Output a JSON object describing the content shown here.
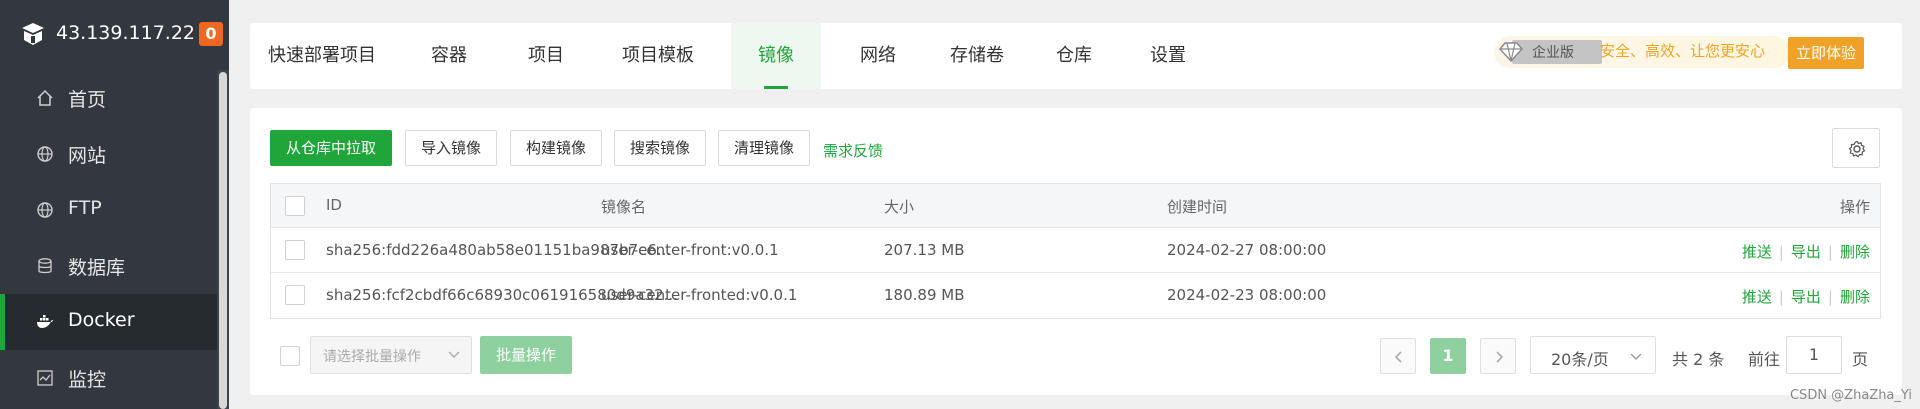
{
  "sidebar": {
    "host": "43.139.117.22",
    "badge": "0",
    "items": [
      {
        "label": "首页",
        "icon": "home-icon"
      },
      {
        "label": "网站",
        "icon": "globe-icon"
      },
      {
        "label": "FTP",
        "icon": "globe-icon"
      },
      {
        "label": "数据库",
        "icon": "database-icon"
      },
      {
        "label": "Docker",
        "icon": "docker-icon",
        "active": true
      },
      {
        "label": "监控",
        "icon": "monitor-icon"
      }
    ]
  },
  "tabs": {
    "items": [
      "快速部署项目",
      "容器",
      "项目",
      "项目模板",
      "镜像",
      "网络",
      "存储卷",
      "仓库",
      "设置"
    ],
    "active": "镜像"
  },
  "enterprise": {
    "tag": "企业版",
    "slogan": "安全、高效、让您更安心",
    "try_label": "立即体验"
  },
  "toolbar": {
    "pull": "从仓库中拉取",
    "import": "导入镜像",
    "build": "构建镜像",
    "search": "搜索镜像",
    "clean": "清理镜像",
    "feedback": "需求反馈"
  },
  "table": {
    "headers": {
      "id": "ID",
      "name": "镜像名",
      "size": "大小",
      "created": "创建时间",
      "ops": "操作"
    },
    "rows": [
      {
        "id": "sha256:fdd226a480ab58e01151ba987b7e6...",
        "name": "user-center-front:v0.0.1",
        "size": "207.13 MB",
        "created": "2024-02-27 08:00:00"
      },
      {
        "id": "sha256:fcf2cbdf66c68930c061916580d9a32...",
        "name": "user-center-fronted:v0.0.1",
        "size": "180.89 MB",
        "created": "2024-02-23 08:00:00"
      }
    ],
    "ops": {
      "push": "推送",
      "export": "导出",
      "delete": "删除"
    }
  },
  "footer": {
    "batch_placeholder": "请选择批量操作",
    "batch_button": "批量操作",
    "current_page": "1",
    "page_size": "20条/页",
    "total": "共 2 条",
    "goto_prefix": "前往",
    "goto_value": "1",
    "goto_suffix": "页"
  },
  "watermark": "CSDN @ZhaZha_Yi",
  "colors": {
    "accent": "#20a53a",
    "sidebar_bg": "#32383e",
    "enterprise": "#f0a228"
  }
}
